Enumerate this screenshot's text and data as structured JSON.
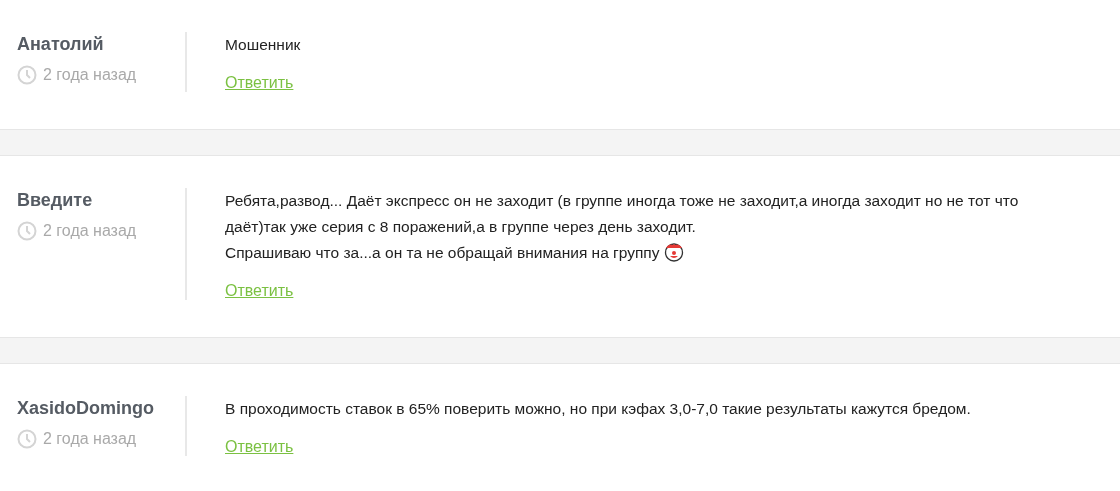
{
  "comments": [
    {
      "author": "Анатолий",
      "time": "2 года назад",
      "paragraphs": [
        "Мошенник"
      ],
      "emoji": false,
      "reply": "Ответить"
    },
    {
      "author": "Введите",
      "time": "2 года назад",
      "paragraphs": [
        "Ребята,развод... Даёт экспресс он не заходит (в группе иногда тоже не заходит,а иногда заходит но не тот что даёт)так уже серия с 8 поражений,а в группе через день заходит.",
        "Спрашиваю что за...а он та не обращай внимания на группу"
      ],
      "emoji": true,
      "reply": "Ответить"
    },
    {
      "author": "XasidoDomingo",
      "time": "2 года назад",
      "paragraphs": [
        "В проходимость ставок в 65% поверить можно, но при кэфах 3,0-7,0 такие результаты кажутся бредом."
      ],
      "emoji": false,
      "reply": "Ответить"
    }
  ]
}
